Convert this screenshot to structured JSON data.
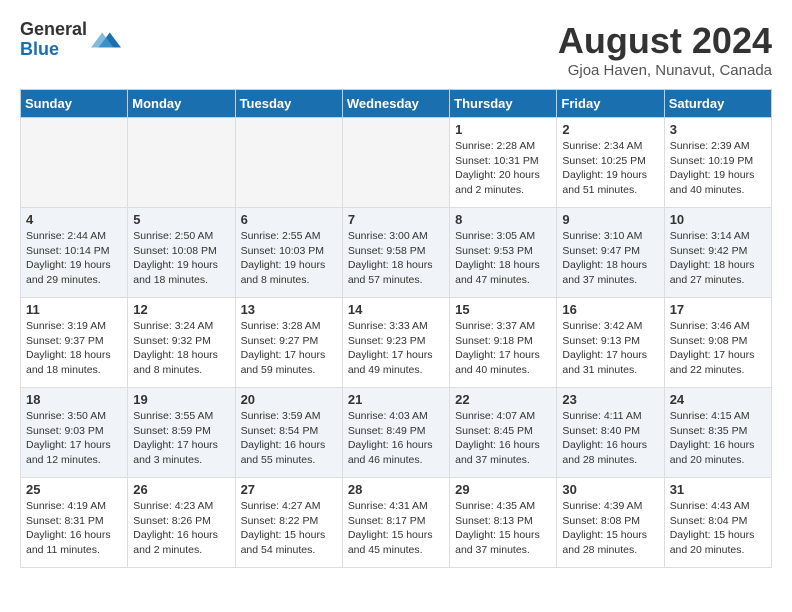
{
  "header": {
    "logo_general": "General",
    "logo_blue": "Blue",
    "month_title": "August 2024",
    "location": "Gjoa Haven, Nunavut, Canada"
  },
  "days_of_week": [
    "Sunday",
    "Monday",
    "Tuesday",
    "Wednesday",
    "Thursday",
    "Friday",
    "Saturday"
  ],
  "weeks": [
    {
      "row": 1,
      "cells": [
        {
          "day": "",
          "empty": true,
          "content": ""
        },
        {
          "day": "",
          "empty": true,
          "content": ""
        },
        {
          "day": "",
          "empty": true,
          "content": ""
        },
        {
          "day": "",
          "empty": true,
          "content": ""
        },
        {
          "day": "1",
          "empty": false,
          "content": "Sunrise: 2:28 AM\nSunset: 10:31 PM\nDaylight: 20 hours\nand 2 minutes."
        },
        {
          "day": "2",
          "empty": false,
          "content": "Sunrise: 2:34 AM\nSunset: 10:25 PM\nDaylight: 19 hours\nand 51 minutes."
        },
        {
          "day": "3",
          "empty": false,
          "content": "Sunrise: 2:39 AM\nSunset: 10:19 PM\nDaylight: 19 hours\nand 40 minutes."
        }
      ]
    },
    {
      "row": 2,
      "cells": [
        {
          "day": "4",
          "empty": false,
          "content": "Sunrise: 2:44 AM\nSunset: 10:14 PM\nDaylight: 19 hours\nand 29 minutes."
        },
        {
          "day": "5",
          "empty": false,
          "content": "Sunrise: 2:50 AM\nSunset: 10:08 PM\nDaylight: 19 hours\nand 18 minutes."
        },
        {
          "day": "6",
          "empty": false,
          "content": "Sunrise: 2:55 AM\nSunset: 10:03 PM\nDaylight: 19 hours\nand 8 minutes."
        },
        {
          "day": "7",
          "empty": false,
          "content": "Sunrise: 3:00 AM\nSunset: 9:58 PM\nDaylight: 18 hours\nand 57 minutes."
        },
        {
          "day": "8",
          "empty": false,
          "content": "Sunrise: 3:05 AM\nSunset: 9:53 PM\nDaylight: 18 hours\nand 47 minutes."
        },
        {
          "day": "9",
          "empty": false,
          "content": "Sunrise: 3:10 AM\nSunset: 9:47 PM\nDaylight: 18 hours\nand 37 minutes."
        },
        {
          "day": "10",
          "empty": false,
          "content": "Sunrise: 3:14 AM\nSunset: 9:42 PM\nDaylight: 18 hours\nand 27 minutes."
        }
      ]
    },
    {
      "row": 3,
      "cells": [
        {
          "day": "11",
          "empty": false,
          "content": "Sunrise: 3:19 AM\nSunset: 9:37 PM\nDaylight: 18 hours\nand 18 minutes."
        },
        {
          "day": "12",
          "empty": false,
          "content": "Sunrise: 3:24 AM\nSunset: 9:32 PM\nDaylight: 18 hours\nand 8 minutes."
        },
        {
          "day": "13",
          "empty": false,
          "content": "Sunrise: 3:28 AM\nSunset: 9:27 PM\nDaylight: 17 hours\nand 59 minutes."
        },
        {
          "day": "14",
          "empty": false,
          "content": "Sunrise: 3:33 AM\nSunset: 9:23 PM\nDaylight: 17 hours\nand 49 minutes."
        },
        {
          "day": "15",
          "empty": false,
          "content": "Sunrise: 3:37 AM\nSunset: 9:18 PM\nDaylight: 17 hours\nand 40 minutes."
        },
        {
          "day": "16",
          "empty": false,
          "content": "Sunrise: 3:42 AM\nSunset: 9:13 PM\nDaylight: 17 hours\nand 31 minutes."
        },
        {
          "day": "17",
          "empty": false,
          "content": "Sunrise: 3:46 AM\nSunset: 9:08 PM\nDaylight: 17 hours\nand 22 minutes."
        }
      ]
    },
    {
      "row": 4,
      "cells": [
        {
          "day": "18",
          "empty": false,
          "content": "Sunrise: 3:50 AM\nSunset: 9:03 PM\nDaylight: 17 hours\nand 12 minutes."
        },
        {
          "day": "19",
          "empty": false,
          "content": "Sunrise: 3:55 AM\nSunset: 8:59 PM\nDaylight: 17 hours\nand 3 minutes."
        },
        {
          "day": "20",
          "empty": false,
          "content": "Sunrise: 3:59 AM\nSunset: 8:54 PM\nDaylight: 16 hours\nand 55 minutes."
        },
        {
          "day": "21",
          "empty": false,
          "content": "Sunrise: 4:03 AM\nSunset: 8:49 PM\nDaylight: 16 hours\nand 46 minutes."
        },
        {
          "day": "22",
          "empty": false,
          "content": "Sunrise: 4:07 AM\nSunset: 8:45 PM\nDaylight: 16 hours\nand 37 minutes."
        },
        {
          "day": "23",
          "empty": false,
          "content": "Sunrise: 4:11 AM\nSunset: 8:40 PM\nDaylight: 16 hours\nand 28 minutes."
        },
        {
          "day": "24",
          "empty": false,
          "content": "Sunrise: 4:15 AM\nSunset: 8:35 PM\nDaylight: 16 hours\nand 20 minutes."
        }
      ]
    },
    {
      "row": 5,
      "cells": [
        {
          "day": "25",
          "empty": false,
          "content": "Sunrise: 4:19 AM\nSunset: 8:31 PM\nDaylight: 16 hours\nand 11 minutes."
        },
        {
          "day": "26",
          "empty": false,
          "content": "Sunrise: 4:23 AM\nSunset: 8:26 PM\nDaylight: 16 hours\nand 2 minutes."
        },
        {
          "day": "27",
          "empty": false,
          "content": "Sunrise: 4:27 AM\nSunset: 8:22 PM\nDaylight: 15 hours\nand 54 minutes."
        },
        {
          "day": "28",
          "empty": false,
          "content": "Sunrise: 4:31 AM\nSunset: 8:17 PM\nDaylight: 15 hours\nand 45 minutes."
        },
        {
          "day": "29",
          "empty": false,
          "content": "Sunrise: 4:35 AM\nSunset: 8:13 PM\nDaylight: 15 hours\nand 37 minutes."
        },
        {
          "day": "30",
          "empty": false,
          "content": "Sunrise: 4:39 AM\nSunset: 8:08 PM\nDaylight: 15 hours\nand 28 minutes."
        },
        {
          "day": "31",
          "empty": false,
          "content": "Sunrise: 4:43 AM\nSunset: 8:04 PM\nDaylight: 15 hours\nand 20 minutes."
        }
      ]
    }
  ]
}
